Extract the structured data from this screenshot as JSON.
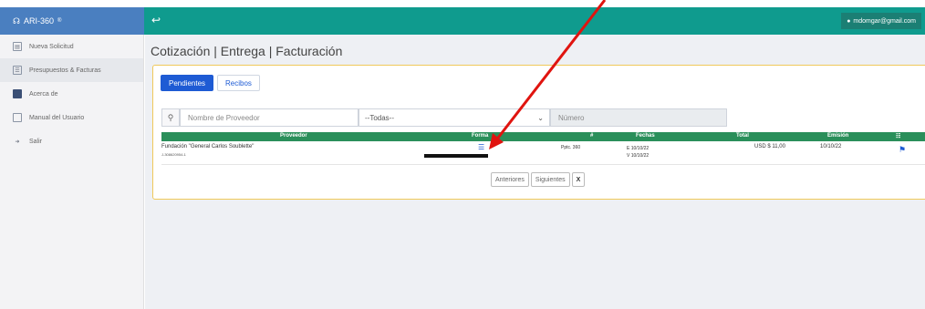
{
  "app": {
    "name": "ARI-360",
    "registered": "®"
  },
  "topbar": {
    "toggle_icon": "sign-in-icon",
    "user_email": "mdomgar@gmail.com"
  },
  "sidebar": {
    "items": [
      {
        "label": "Nueva Solicitud",
        "icon": "document-icon"
      },
      {
        "label": "Presupuestos & Facturas",
        "icon": "list-icon"
      },
      {
        "label": "Acerca de",
        "icon": "flag-icon"
      },
      {
        "label": "Manual del Usuario",
        "icon": "book-icon"
      },
      {
        "label": "Salir",
        "icon": "logout-icon"
      }
    ]
  },
  "page": {
    "title": "Cotización | Entrega | Facturación"
  },
  "tabs": [
    {
      "label": "Pendientes"
    },
    {
      "label": "Recibos"
    }
  ],
  "filters": {
    "provider_placeholder": "Nombre de Proveedor",
    "select_value": "--Todas--",
    "number_placeholder": "Número"
  },
  "table": {
    "headers": {
      "proveedor": "Proveedor",
      "formato": "Forma",
      "numero": "#",
      "fechas": "Fechas",
      "total": "Total",
      "emision": "Emisión",
      "acciones": "☷"
    },
    "rows": [
      {
        "proveedor": "Fundación \"General Carlos Soublette\"",
        "rif": "J-308620954-1",
        "numero": "Pptc. 360",
        "fecha_e": "E 10/10/22",
        "fecha_v": "V 10/10/22",
        "total": "USD $ 11,00",
        "emision": "10/10/22"
      }
    ]
  },
  "pager": {
    "prev": "Anteriores",
    "next": "Siguientes",
    "close": "X"
  },
  "colors": {
    "topbar": "#0f9b8e",
    "sidebar_head": "#4a7fc0",
    "header_row": "#2a8f5a",
    "accent": "#1e5bd4",
    "arrow": "#e0140f"
  }
}
